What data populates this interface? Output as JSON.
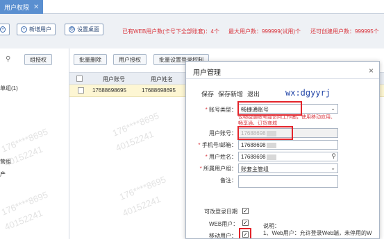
{
  "tab": {
    "label": "用户权限",
    "close": "✕"
  },
  "toolbar": {
    "btn_partial": "",
    "btn_add_user": "新增用户",
    "btn_set_desktop": "设置桌面",
    "stat_web": "已有WEB用户数(卡号下全部账套)：4个",
    "stat_max": "最大用户数：999999(试用)个",
    "stat_can_create": "还可创建用户数：999995个"
  },
  "left": {
    "grant_button": "组授权",
    "tree": [
      "单组(1)",
      "营组",
      "产"
    ]
  },
  "grid": {
    "buttons": [
      "批量删除",
      "用户授权",
      "批量设置登录控制"
    ],
    "headers": [
      "用户账号",
      "用户姓名"
    ],
    "rows": [
      {
        "account": "17688698695",
        "name": "17688698695"
      }
    ]
  },
  "watermarks": [
    "176****8695",
    "40152241",
    "176****8695",
    "40152241",
    "176****8695",
    "40152241",
    "176****8695",
    "40152241"
  ],
  "dialog": {
    "title": "用户管理",
    "close": "×",
    "actions": [
      "保存",
      "保存新增",
      "退出"
    ],
    "annotation": "wx:dgyyrj",
    "fields": {
      "account_type_label": "账号类型：",
      "account_type_value": "畅捷通账号",
      "account_type_hint": "仅畅捷通账号能访问工作圈，使用移动应用、畅享通、订货商城",
      "user_account_label": "用户账号：",
      "user_account_value": "17688698",
      "phone_label": "手机号/邮箱：",
      "phone_value": "17688698",
      "name_label": "用户姓名：",
      "name_value": "17688698",
      "group_label": "所属用户组：",
      "group_value": "账套主管组",
      "remark_label": "备注："
    },
    "checks": {
      "change_date_label": "可改登录日期",
      "web_user_label": "WEB用户：",
      "mobile_user_label": "移动用户："
    },
    "note_title": "说明：",
    "note_line1": "1、Web用户：允许登录Web端，未停用的W"
  },
  "icons": {
    "add": "plus-circle-icon",
    "desktop": "gear-icon",
    "search": "search-icon",
    "chevron": "chevron-down-icon",
    "close": "close-icon"
  },
  "colors": {
    "tab": "#5a8fd0",
    "alert": "#d9363e",
    "highlight_row": "#fdf6d3",
    "annotation": "#2447a8"
  }
}
